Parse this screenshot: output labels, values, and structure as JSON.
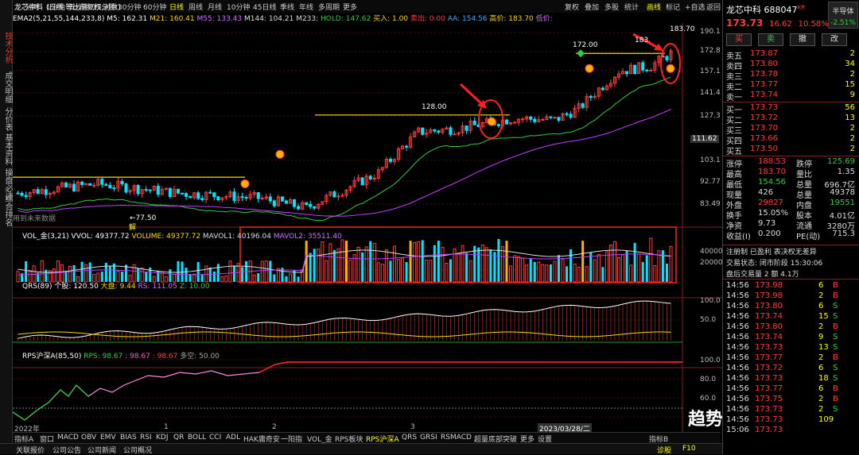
{
  "title_bar": {
    "stock": "龙芯中科",
    "chart_mode": "(日线,等比前复权,对数)"
  },
  "top_tabs": [
    "分时",
    "1分钟",
    "5分钟",
    "15分钟",
    "30分钟",
    "60分钟",
    "日线",
    "周线",
    "月线",
    "10分钟",
    "45日线",
    "季线",
    "年线",
    "多周期",
    "更多"
  ],
  "top_right_tabs": [
    "复权",
    "叠加",
    "多股",
    "统计",
    "画线",
    "标记",
    "+自选",
    "返回"
  ],
  "ma_line": {
    "label": "EMA2(5,21,55,144,233,8)",
    "m5": "M5: 162.31",
    "m21": "M21: 160.41",
    "m55": "M55: 133.43",
    "m144": "M144: 104.21",
    "m233": "M233: ",
    "hold": "HOLD: 147.62",
    "buy": "买入: 1.00",
    "sell": "卖出: 0.00",
    "aa": "AA: 154.56",
    "high": "高价: 183.70",
    "low": "低价: ",
    "mid": "中"
  },
  "left_tabs": [
    "技术分析",
    "成交明细",
    "分价表",
    "基本资料",
    "操盘必读",
    "综合排名"
  ],
  "price_axis": [
    "190.1",
    "172.8",
    "157.1",
    "141.4",
    "127.3",
    "111.62",
    "103.1",
    "92.77",
    "83.49"
  ],
  "annotations": {
    "p183": "183.70",
    "p183b": "183.",
    "p172": "172.00",
    "p128": "128.00",
    "p77": "←77.50",
    "caption": "用到未来数据",
    "jie": "解"
  },
  "volume": {
    "label": "VOL_金(3,21)",
    "vvol": "VVOL: 49377.72",
    "volume": "VOLUME: 49377.72",
    "mavol1": "MAVOL1: 40196.04",
    "mavol2": "MAVOL2: 35511.40",
    "axis": [
      "40000",
      "20000"
    ]
  },
  "qrs": {
    "label": "QRS(89)",
    "index": "个股: 120.50",
    "market": "大盘: 9.44",
    "rs": "RS: 111.05",
    "z": "Z: 10.00",
    "axis": [
      "100.0",
      "50.0"
    ]
  },
  "rps": {
    "label": "RPS沪深A(85,50)",
    "rps1": "RPS: 98.67",
    "rps2": ": 98.67",
    "rps3": ": 98.67",
    "duo": "多空: 50.00",
    "axis": [
      "100.0",
      "80.0",
      "60.0"
    ]
  },
  "date_axis": [
    "2022年",
    "1",
    "2",
    "3",
    "2023/03/28/二"
  ],
  "right_header": {
    "name": "龙芯中科",
    "code": "688047",
    "tag": "KR",
    "sector": "半导体",
    "sector_pct": "-2.51%",
    "price": "173.73",
    "change": "16.62",
    "pct": "10.58%"
  },
  "trade_buttons": [
    "买",
    "卖",
    "撤",
    "改"
  ],
  "sell_levels": [
    {
      "l": "卖五",
      "p": "173.87",
      "v": "2"
    },
    {
      "l": "卖四",
      "p": "173.80",
      "v": "34"
    },
    {
      "l": "卖三",
      "p": "173.78",
      "v": "2"
    },
    {
      "l": "卖二",
      "p": "173.77",
      "v": "15"
    },
    {
      "l": "卖一",
      "p": "173.74",
      "v": "9"
    }
  ],
  "buy_levels": [
    {
      "l": "买一",
      "p": "173.73",
      "v": "56"
    },
    {
      "l": "买二",
      "p": "173.72",
      "v": "13"
    },
    {
      "l": "买三",
      "p": "173.70",
      "v": "2"
    },
    {
      "l": "买四",
      "p": "173.66",
      "v": "2"
    },
    {
      "l": "买五",
      "p": "173.50",
      "v": "2"
    }
  ],
  "stats": [
    {
      "a": "涨停",
      "b": "188.53",
      "c": "跌停",
      "d": "125.69"
    },
    {
      "a": "最高",
      "b": "183.70",
      "c": "量比",
      "d": "1.35"
    },
    {
      "a": "最低",
      "b": "154.56",
      "c": "总量",
      "d": "696.7亿"
    },
    {
      "a": "现量",
      "b": "426",
      "c": "总量",
      "d": "49378"
    },
    {
      "a": "外盘",
      "b": "29827",
      "c": "内盘",
      "d": "19551"
    },
    {
      "a": "换手",
      "b": "15.05%",
      "c": "股本",
      "d": "4.01亿"
    },
    {
      "a": "净资",
      "b": "9.73",
      "c": "流通",
      "d": "3280万"
    },
    {
      "a": "收益(I)",
      "b": "0.200",
      "c": "PE(动)",
      "d": "715.3"
    }
  ],
  "info_lines": [
    "注册制  已盈利  表决权无差异",
    "交易状态: 闭市阶段 15:30:06",
    "盘后交易量 2 额 4.1万"
  ],
  "ticks": [
    {
      "t": "14:56",
      "p": "173.98",
      "v": "6",
      "s": "B"
    },
    {
      "t": "14:56",
      "p": "173.98",
      "v": "2",
      "s": "B"
    },
    {
      "t": "14:56",
      "p": "173.80",
      "v": "6",
      "s": "S"
    },
    {
      "t": "14:56",
      "p": "173.74",
      "v": "15",
      "s": "S"
    },
    {
      "t": "14:56",
      "p": "173.80",
      "v": "2",
      "s": "B"
    },
    {
      "t": "14:56",
      "p": "173.74",
      "v": "9",
      "s": "S"
    },
    {
      "t": "14:56",
      "p": "173.73",
      "v": "13",
      "s": "S"
    },
    {
      "t": "14:56",
      "p": "173.77",
      "v": "2",
      "s": "B"
    },
    {
      "t": "14:56",
      "p": "173.72",
      "v": "6",
      "s": "S"
    },
    {
      "t": "14:56",
      "p": "173.73",
      "v": "18",
      "s": "S"
    },
    {
      "t": "14:56",
      "p": "173.77",
      "v": "6",
      "s": "B"
    },
    {
      "t": "14:56",
      "p": "173.75",
      "v": "2",
      "s": "B"
    },
    {
      "t": "14:56",
      "p": "173.73",
      "v": "2",
      "s": "S"
    },
    {
      "t": "14:56",
      "p": "173.73",
      "v": "109",
      "s": ""
    },
    {
      "t": "15:06",
      "p": "173.73",
      "v": "",
      "": ""
    }
  ],
  "bottom_tabs": [
    "指标A",
    "窗口",
    "MACD",
    "OBV",
    "EMV",
    "BIAS",
    "RSI",
    "KDJ",
    "QR",
    "BOLL",
    "CCI",
    "ADL",
    "HAK庸奇安",
    "一阳指",
    "VOL_金",
    "RPS板块",
    "RPS沪深A",
    "QRS",
    "GRSI",
    "RSMACD",
    "超量底部突破",
    "更多",
    "设置",
    "指标B"
  ],
  "status_bar": [
    "关联报价",
    "公司公告",
    "公司新闻",
    "公司概况",
    "诊股",
    "F10"
  ],
  "watermark": "趋势一阳指",
  "colors": {
    "up": "#ff3b3b",
    "down": "#00e5ff",
    "ma_yellow": "#ffd700",
    "ma_purple": "#c040ff",
    "ma_green": "#2ecc40",
    "accent_red": "#e53935"
  }
}
